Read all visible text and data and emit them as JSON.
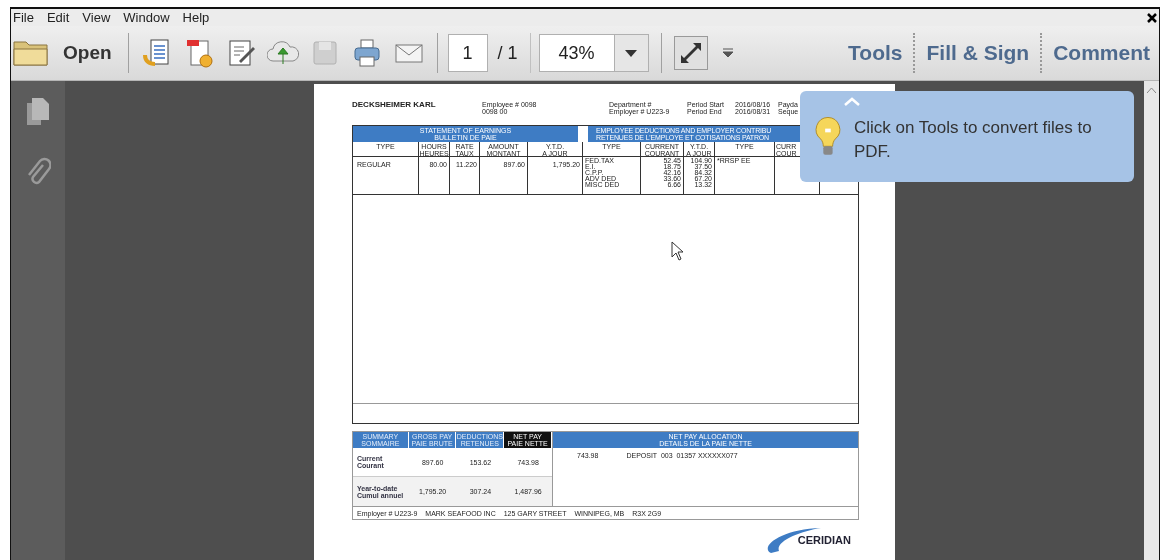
{
  "menu": [
    {
      "label": "File"
    },
    {
      "label": "Edit"
    },
    {
      "label": "View"
    },
    {
      "label": "Window"
    },
    {
      "label": "Help"
    }
  ],
  "toolbar": {
    "open_label": "Open",
    "page": "1",
    "page_total": "/ 1",
    "zoom": "43%",
    "panes": [
      {
        "label": "Tools"
      },
      {
        "label": "Fill & Sign"
      },
      {
        "label": "Comment"
      }
    ]
  },
  "tooltip": {
    "text": "Click on Tools to convert files to PDF."
  },
  "document": {
    "employee_name": "DECKSHEIMER KARL",
    "employee_no": [
      "Employee # 0098",
      "0098 00"
    ],
    "department": [
      "Department #",
      "Employer # U223-9"
    ],
    "period_labels": [
      "Period Start",
      "Period End"
    ],
    "period_dates": [
      "2016/08/16",
      "2016/08/31"
    ],
    "cut_labels": [
      "Payda",
      "Seque"
    ],
    "earnings": {
      "title": [
        "STATEMENT OF EARNINGS",
        "BULLETIN DE PAIE"
      ],
      "columns": [
        {
          "lines": [
            "TYPE"
          ]
        },
        {
          "lines": [
            "HOURS",
            "HEURES"
          ]
        },
        {
          "lines": [
            "RATE",
            "TAUX"
          ]
        },
        {
          "lines": [
            "AMOUNT",
            "MONTANT"
          ]
        },
        {
          "lines": [
            "Y.T.D.",
            "A JOUR"
          ]
        }
      ],
      "rows": [
        [
          "REGULAR",
          "80.00",
          "11.220",
          "897.60",
          "1,795.20"
        ]
      ]
    },
    "deductions": {
      "title": [
        "EMPLOYEE DEDUCTIONS AND EMPLOYER CONTRIBU",
        "RETENUES DE L'EMPLOYE ET COTISATIONS PATRON"
      ],
      "columns": [
        {
          "lines": [
            "TYPE"
          ]
        },
        {
          "lines": [
            "CURRENT",
            "COURANT"
          ]
        },
        {
          "lines": [
            "Y.T.D.",
            "A JOUR"
          ]
        },
        {
          "lines": [
            "TYPE"
          ]
        },
        {
          "lines": [
            "CURR",
            "COUR"
          ]
        }
      ],
      "rows": [
        [
          "FED.TAX",
          "52.45",
          "104.90",
          "*RRSP EE"
        ],
        [
          "E.I.",
          "18.75",
          "37.50",
          ""
        ],
        [
          "C.P.P.",
          "42.16",
          "84.32",
          ""
        ],
        [
          "ADV DED",
          "33.60",
          "67.20",
          ""
        ],
        [
          "MISC DED",
          "6.66",
          "13.32",
          ""
        ]
      ]
    },
    "summary": {
      "columns": [
        {
          "lines": [
            "SUMMARY",
            "SOMMAIRE"
          ],
          "highlighted": false
        },
        {
          "lines": [
            "GROSS PAY",
            "PAIE BRUTE"
          ],
          "highlighted": false
        },
        {
          "lines": [
            "DEDUCTIONS",
            "RETENUES"
          ],
          "highlighted": false
        },
        {
          "lines": [
            "NET PAY",
            "PAIE NETTE"
          ],
          "highlighted": true
        }
      ],
      "rows": [
        {
          "label": [
            "Current",
            "Courant"
          ],
          "values": [
            "897.60",
            "153.62",
            "743.98"
          ]
        },
        {
          "label": [
            "Year-to-date",
            "Cumul annuel"
          ],
          "values": [
            "1,795.20",
            "307.24",
            "1,487.96"
          ]
        }
      ]
    },
    "allocation": {
      "title": [
        "NET PAY ALLOCATION",
        "DETAILS DE LA PAIE NETTE"
      ],
      "amount": "743.98",
      "detail": "DEPOSIT  003  01357 XXXXXX077"
    },
    "footer": [
      "Employer # U223-9",
      "MARK SEAFOOD INC",
      "125 GARY STREET",
      "WINNIPEG, MB",
      "R3X 2G9"
    ],
    "logo": "CERIDIAN"
  }
}
